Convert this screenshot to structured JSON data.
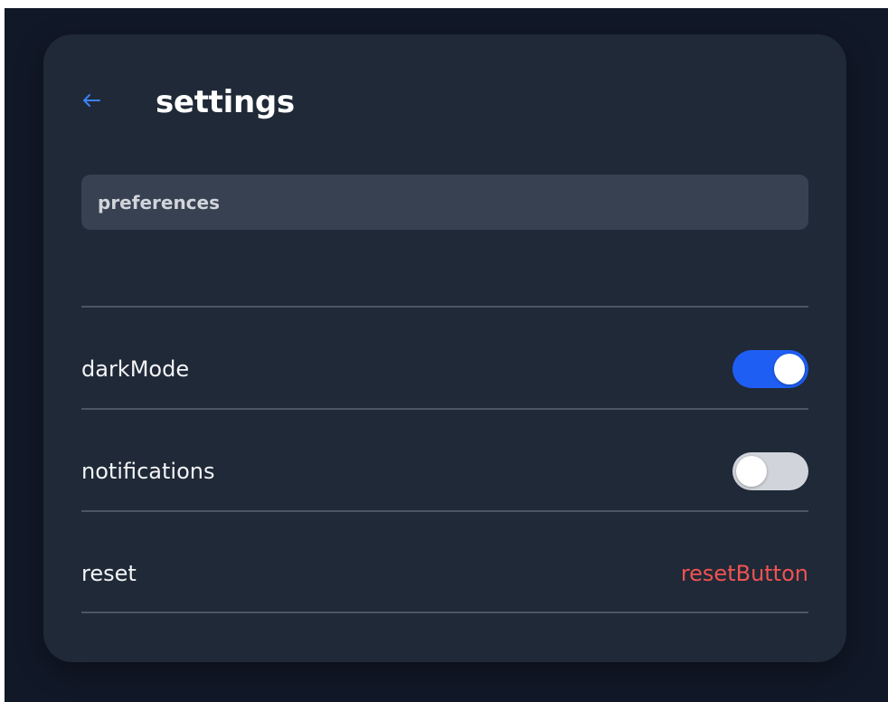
{
  "header": {
    "back_icon": "arrow-left-icon",
    "title": "settings"
  },
  "section": {
    "label": "preferences"
  },
  "settings": {
    "dark_mode": {
      "label": "darkMode",
      "enabled": true
    },
    "notifications": {
      "label": "notifications",
      "enabled": false
    },
    "reset": {
      "label": "reset",
      "button_label": "resetButton"
    }
  },
  "colors": {
    "page_background": "#111827",
    "card_background": "#1f2937",
    "section_background": "#374151",
    "accent": "#1e5ef3",
    "back_icon": "#3b82f6",
    "toggle_off": "#d1d5db",
    "danger": "#f05252"
  }
}
